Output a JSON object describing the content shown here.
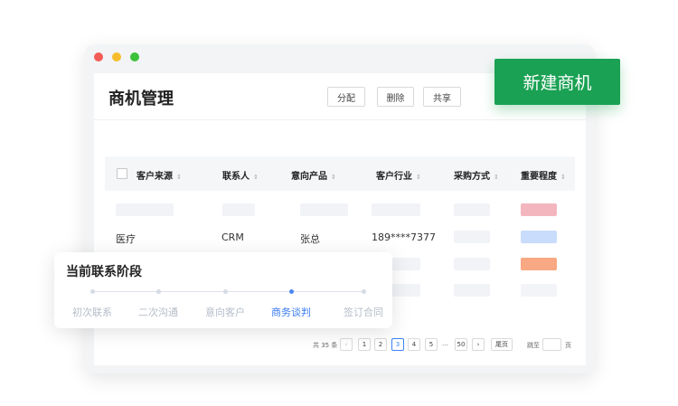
{
  "window": {
    "title": "商机管理",
    "toolbar": {
      "assign_label": "分配",
      "delete_label": "删除",
      "share_label": "共享"
    }
  },
  "new_button_label": "新建商机",
  "table": {
    "columns": [
      "客户来源",
      "联系人",
      "意向产品",
      "客户行业",
      "采购方式",
      "重要程度"
    ],
    "sort_glyph": "⇕",
    "row2": {
      "source": "医疗",
      "contact": "CRM",
      "product": "张总",
      "industry": "189****7377"
    },
    "importance_colors": [
      "#f4b6be",
      "#c9dcfb",
      "#f8a882",
      "#f3f4f7"
    ]
  },
  "pagination": {
    "total": "共 35 条",
    "prev": "‹",
    "pages": [
      "1",
      "2",
      "3",
      "4",
      "5"
    ],
    "current": "3",
    "ellipsis": "···",
    "last": "50",
    "next": "›",
    "last_page_label": "尾页",
    "jump_label": "跳至",
    "page_unit": "页"
  },
  "stage": {
    "title": "当前联系阶段",
    "steps": [
      "初次联系",
      "二次沟通",
      "意向客户",
      "商务谈判",
      "签订合同"
    ],
    "current_index": 3
  },
  "colors": {
    "accent_green": "#1aa153",
    "accent_blue": "#3b7cf2"
  }
}
